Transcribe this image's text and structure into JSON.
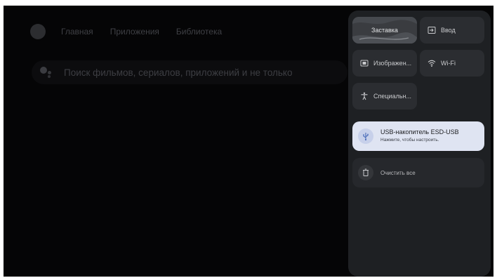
{
  "home": {
    "nav": [
      "Главная",
      "Приложения",
      "Библиотека"
    ],
    "search_text": "Поиск фильмов, сериалов, приложений и не только"
  },
  "quick_settings": {
    "screensaver": "Заставка",
    "input": "Ввод",
    "picture": "Изображен...",
    "wifi": "Wi-Fi",
    "accessibility": "Специальн..."
  },
  "notification": {
    "title": "USB-накопитель ESD-USB",
    "subtitle": "Нажмите, чтобы настроить."
  },
  "clear_all": "Очистить все",
  "colors": {
    "panel": "#1e2023",
    "tile": "#2b2d31",
    "notification_bg": "#dfe4f2",
    "accent": "#3a5fb3"
  },
  "icons": {
    "screensaver": "waves-decoration",
    "input": "input-icon",
    "picture": "picture-icon",
    "wifi": "wifi-icon",
    "accessibility": "accessibility-icon",
    "usb": "usb-icon",
    "clear": "trash-icon"
  }
}
